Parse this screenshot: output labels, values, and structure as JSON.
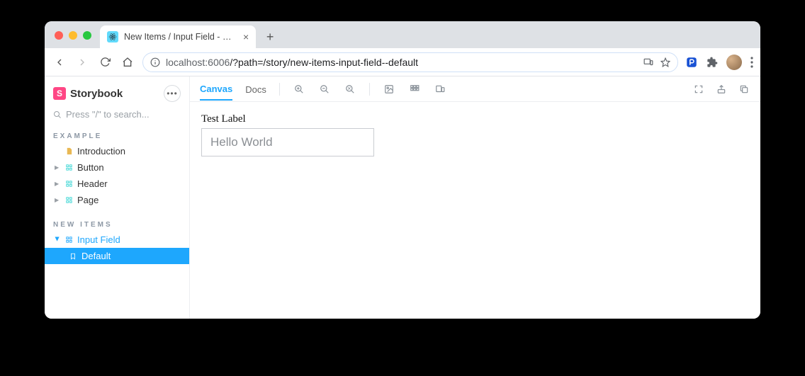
{
  "browser": {
    "tab_title": "New Items / Input Field - Defau",
    "url_host": "localhost",
    "url_port": ":6006",
    "url_path": "/?path=/story/new-items-input-field--default"
  },
  "sidebar": {
    "logo_text": "Storybook",
    "search_placeholder": "Press \"/\" to search...",
    "sections": [
      {
        "title": "EXAMPLE",
        "items": [
          {
            "label": "Introduction",
            "kind": "doc"
          },
          {
            "label": "Button",
            "kind": "component"
          },
          {
            "label": "Header",
            "kind": "component"
          },
          {
            "label": "Page",
            "kind": "component"
          }
        ]
      },
      {
        "title": "NEW ITEMS",
        "items": [
          {
            "label": "Input Field",
            "kind": "component",
            "expanded": true,
            "children": [
              {
                "label": "Default",
                "kind": "story",
                "active": true
              }
            ]
          }
        ]
      }
    ]
  },
  "tabs": {
    "canvas": "Canvas",
    "docs": "Docs",
    "active": "canvas"
  },
  "story": {
    "label": "Test Label",
    "placeholder": "Hello World"
  }
}
